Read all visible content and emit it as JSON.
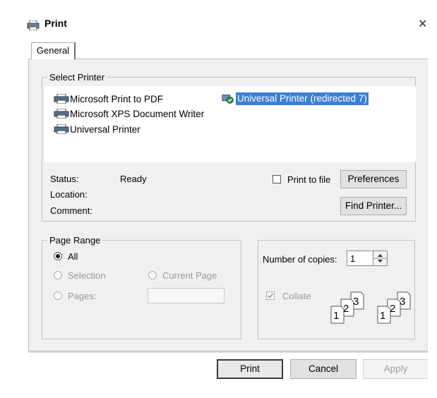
{
  "window": {
    "title": "Print",
    "icon": "printer-icon",
    "close_icon": "close-icon"
  },
  "tabs": [
    {
      "label": "General"
    }
  ],
  "select_printer": {
    "group_label": "Select Printer",
    "printers": [
      {
        "name": "Microsoft Print to PDF",
        "icon": "printer-icon"
      },
      {
        "name": "Microsoft XPS Document Writer",
        "icon": "printer-icon"
      },
      {
        "name": "Universal Printer",
        "icon": "printer-icon"
      },
      {
        "name": "Universal Printer  (redirected 7)",
        "icon": "default-printer-icon",
        "selected": true
      }
    ],
    "status_label": "Status:",
    "status_value": "Ready",
    "location_label": "Location:",
    "comment_label": "Comment:",
    "print_to_file_label": "Print to file",
    "print_to_file_checked": false,
    "preferences_label": "Preferences",
    "find_printer_label": "Find Printer..."
  },
  "page_range": {
    "group_label": "Page Range",
    "all_label": "All",
    "selection_label": "Selection",
    "current_page_label": "Current Page",
    "pages_label": "Pages:",
    "selected": "All"
  },
  "copies": {
    "label": "Number of copies:",
    "value": "1",
    "collate_label": "Collate",
    "collate_checked": true,
    "collate_pages": [
      "1",
      "2",
      "3"
    ]
  },
  "buttons": {
    "print": "Print",
    "cancel": "Cancel",
    "apply": "Apply"
  },
  "colors": {
    "selection": "#3b7fd4",
    "dialog_bg": "#f0f0f0"
  }
}
